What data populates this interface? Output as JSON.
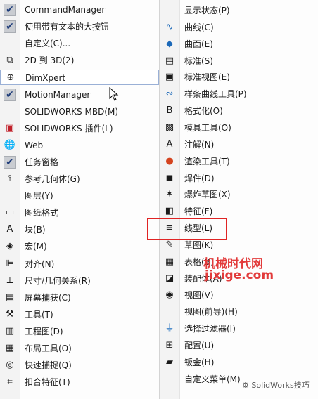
{
  "left_menu": [
    {
      "label": "CommandManager",
      "icon": "checkbox-checked",
      "checked": true
    },
    {
      "label": "使用带有文本的大按钮",
      "icon": "checkbox-checked",
      "checked": true
    },
    {
      "label": "自定义(C)...",
      "icon": ""
    },
    {
      "label": "2D 到 3D(2)",
      "icon": "2d-to-3d-icon"
    },
    {
      "label": "DimXpert",
      "icon": "crosshair-icon",
      "highlighted": true
    },
    {
      "label": "MotionManager",
      "icon": "checkbox-checked",
      "checked": true
    },
    {
      "label": "SOLIDWORKS MBD(M)",
      "icon": ""
    },
    {
      "label": "SOLIDWORKS 插件(L)",
      "icon": "addin-icon"
    },
    {
      "label": "Web",
      "icon": "globe-icon"
    },
    {
      "label": "任务窗格",
      "icon": "checkbox-checked",
      "checked": true
    },
    {
      "label": "参考几何体(G)",
      "icon": "reference-geometry-icon"
    },
    {
      "label": "图层(Y)",
      "icon": ""
    },
    {
      "label": "图纸格式",
      "icon": "sheet-format-icon"
    },
    {
      "label": "块(B)",
      "icon": "block-icon"
    },
    {
      "label": "宏(M)",
      "icon": "macro-icon"
    },
    {
      "label": "对齐(N)",
      "icon": "align-icon"
    },
    {
      "label": "尺寸/几何关系(R)",
      "icon": "dimension-icon"
    },
    {
      "label": "屏幕捕获(C)",
      "icon": "screen-capture-icon"
    },
    {
      "label": "工具(T)",
      "icon": "tools-icon"
    },
    {
      "label": "工程图(D)",
      "icon": "drawing-icon"
    },
    {
      "label": "布局工具(O)",
      "icon": "layout-tools-icon"
    },
    {
      "label": "快速捕捉(Q)",
      "icon": "quick-snap-icon"
    },
    {
      "label": "扣合特征(T)",
      "icon": "fastening-icon"
    }
  ],
  "right_menu": [
    {
      "label": "显示状态(P)",
      "icon": ""
    },
    {
      "label": "曲线(C)",
      "icon": "curve-icon"
    },
    {
      "label": "曲面(E)",
      "icon": "surface-icon"
    },
    {
      "label": "标准(S)",
      "icon": "standard-icon"
    },
    {
      "label": "标准视图(E)",
      "icon": "standard-views-icon"
    },
    {
      "label": "样条曲线工具(P)",
      "icon": "spline-icon"
    },
    {
      "label": "格式化(O)",
      "icon": "format-icon"
    },
    {
      "label": "模具工具(O)",
      "icon": "mold-tools-icon"
    },
    {
      "label": "注解(N)",
      "icon": "annotation-icon"
    },
    {
      "label": "渲染工具(T)",
      "icon": "render-tools-icon"
    },
    {
      "label": "焊件(D)",
      "icon": "weldment-icon"
    },
    {
      "label": "爆炸草图(X)",
      "icon": "explode-sketch-icon"
    },
    {
      "label": "特征(F)",
      "icon": "features-icon"
    },
    {
      "label": "线型(L)",
      "icon": "line-format-icon",
      "boxed": true
    },
    {
      "label": "草图(K)",
      "icon": "sketch-icon"
    },
    {
      "label": "表格(B)",
      "icon": "table-icon"
    },
    {
      "label": "装配体(A)",
      "icon": "assembly-icon"
    },
    {
      "label": "视图(V)",
      "icon": "view-icon"
    },
    {
      "label": "视图(前导)(H)",
      "icon": ""
    },
    {
      "label": "选择过滤器(I)",
      "icon": "selection-filter-icon"
    },
    {
      "label": "配置(U)",
      "icon": "configuration-icon"
    },
    {
      "label": "钣金(H)",
      "icon": "sheet-metal-icon"
    },
    {
      "label": "自定义菜单(M)",
      "icon": ""
    }
  ],
  "watermark": {
    "line1": "机械时代网",
    "line2": "jixige.com",
    "footer": "SolidWorks技巧"
  },
  "colors": {
    "highlight_border": "#9ab0d6",
    "red_box": "#e02424",
    "watermark": "#e23a3a"
  }
}
